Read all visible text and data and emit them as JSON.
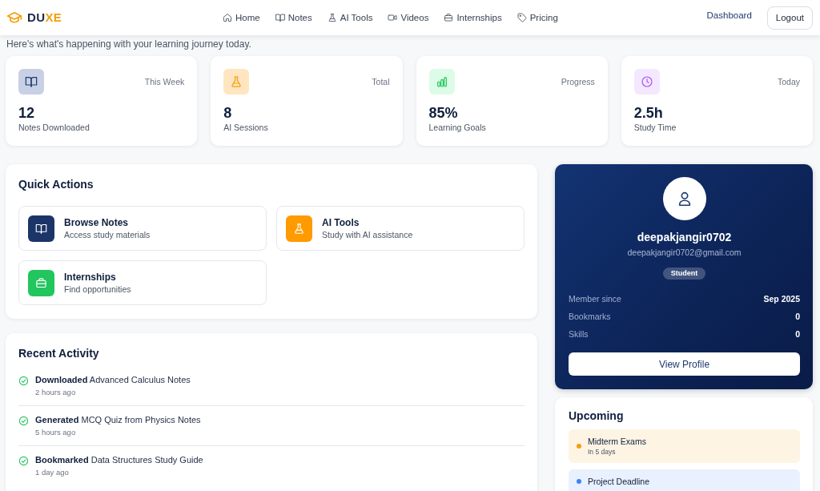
{
  "header": {
    "wordmark": [
      {
        "text": "DU",
        "accent": false
      },
      {
        "text": "XE",
        "accent": true
      }
    ],
    "nav": [
      {
        "label": "Home",
        "kind": "home"
      },
      {
        "label": "Notes",
        "kind": "notes"
      },
      {
        "label": "AI Tools",
        "kind": "ai"
      },
      {
        "label": "Videos",
        "kind": "videos"
      },
      {
        "label": "Internships",
        "kind": "internships"
      },
      {
        "label": "Pricing",
        "kind": "pricing"
      }
    ],
    "dashboard_link": "Dashboard",
    "logout_button": "Logout"
  },
  "subtitle": "Here's what's happening with your learning journey today.",
  "stats": [
    {
      "kind": "notes",
      "period": "This Week",
      "value": "12",
      "label": "Notes Downloaded"
    },
    {
      "kind": "ai",
      "period": "Total",
      "value": "8",
      "label": "AI Sessions"
    },
    {
      "kind": "progress",
      "period": "Progress",
      "value": "85%",
      "label": "Learning Goals"
    },
    {
      "kind": "time",
      "period": "Today",
      "value": "2.5h",
      "label": "Study Time"
    }
  ],
  "quick_actions": {
    "title": "Quick Actions",
    "items": [
      {
        "kind": "notes",
        "title": "Browse Notes",
        "description": "Access study materials"
      },
      {
        "kind": "ai",
        "title": "AI Tools",
        "description": "Study with AI assistance"
      },
      {
        "kind": "internships",
        "title": "Internships",
        "description": "Find opportunities"
      }
    ]
  },
  "recent_activity": {
    "title": "Recent Activity",
    "items": [
      {
        "text": "**Downloaded** Advanced Calculus Notes",
        "time": "2 hours ago"
      },
      {
        "text": "**Generated** MCQ Quiz from Physics Notes",
        "time": "5 hours ago"
      },
      {
        "text": "**Bookmarked** Data Structures Study Guide",
        "time": "1 day ago"
      }
    ]
  },
  "profile": {
    "username": "deepakjangir0702",
    "email": "deepakjangir0702@gmail.com",
    "role": "Student",
    "details": [
      {
        "label": "Member since",
        "value": "Sep 2025"
      },
      {
        "label": "Bookmarks",
        "value": "0"
      },
      {
        "label": "Skills",
        "value": "0"
      }
    ],
    "button": "View Profile"
  },
  "upcoming": {
    "title": "Upcoming",
    "items": [
      {
        "title": "Midterm Exams",
        "due": "In 5 days",
        "color": "#f59e0b"
      },
      {
        "title": "Project Deadline",
        "color": "#3b82f6"
      }
    ]
  }
}
